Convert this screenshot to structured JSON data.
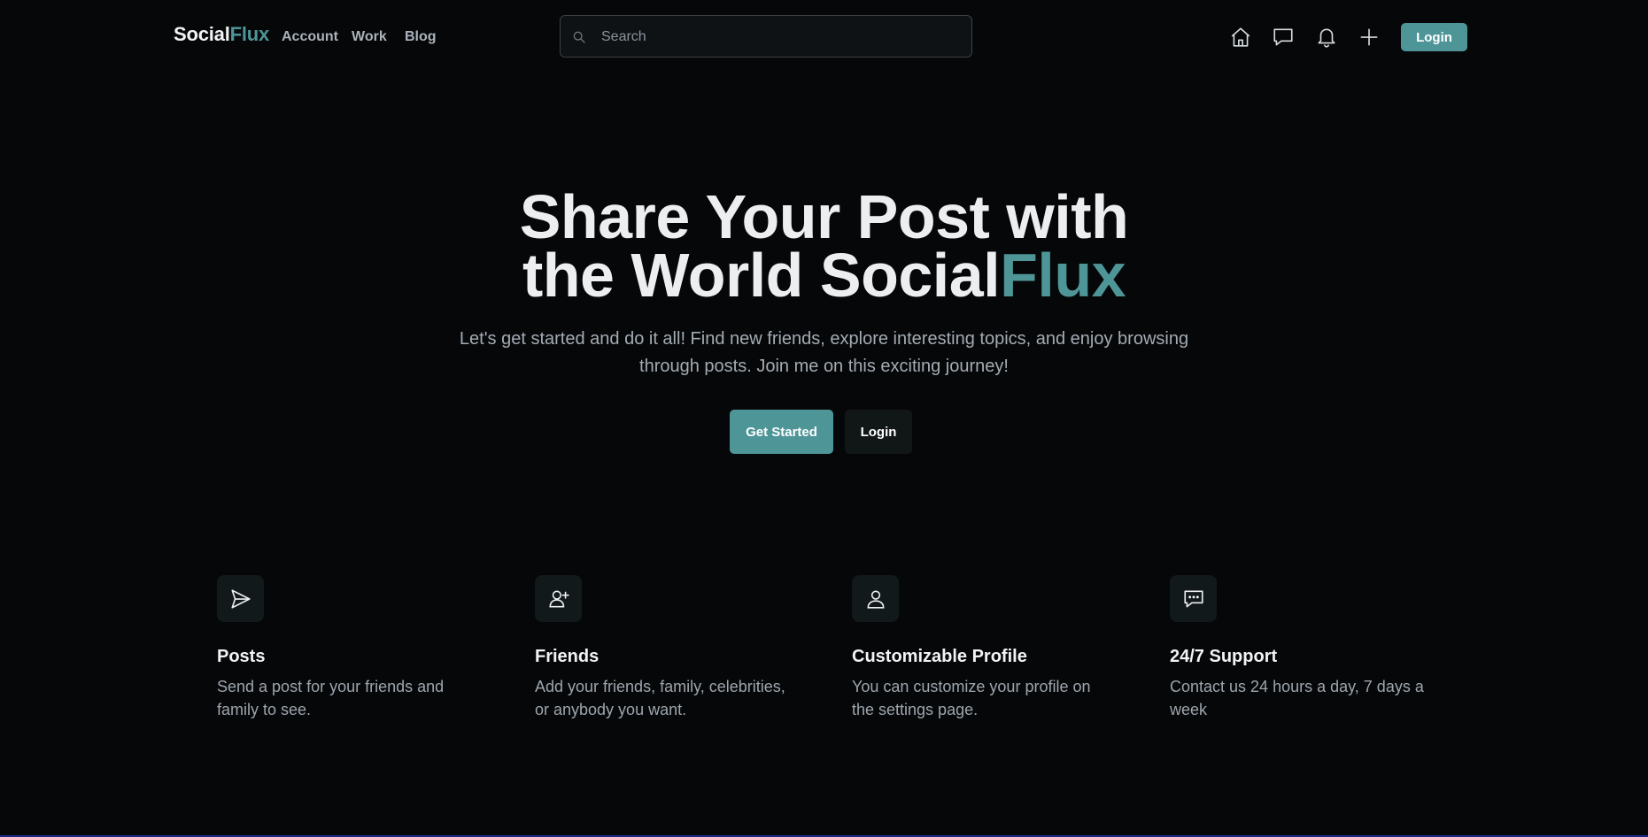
{
  "nav": {
    "brand_part1": "Social",
    "brand_part2": "Flux",
    "links": [
      "Account",
      "Work",
      "Blog"
    ],
    "search_placeholder": "Search",
    "icons": [
      "home-icon",
      "chat-icon",
      "bell-icon",
      "plus-icon"
    ],
    "login_label": "Login"
  },
  "hero": {
    "title_line1": "Share Your Post with",
    "title_line2_prefix": "the World Social",
    "title_line2_accent": "Flux",
    "subtitle": "Let's get started and do it all! Find new friends, explore interesting topics, and enjoy browsing through posts. Join me on this exciting journey!",
    "primary_button": "Get Started",
    "secondary_button": "Login"
  },
  "features": [
    {
      "icon": "send-icon",
      "title": "Posts",
      "description": "Send a post for your friends and family to see."
    },
    {
      "icon": "add-user-icon",
      "title": "Friends",
      "description": "Add your friends, family, celebrities, or anybody you want."
    },
    {
      "icon": "user-icon",
      "title": "Customizable Profile",
      "description": "You can customize your profile on the settings page."
    },
    {
      "icon": "message-dots-icon",
      "title": "24/7 Support",
      "description": "Contact us 24 hours a day, 7 days a week"
    }
  ],
  "colors": {
    "background": "#060708",
    "accent": "#4e9598",
    "text": "#eceef0",
    "muted": "#a3acb4",
    "icon_box": "#12191b"
  }
}
